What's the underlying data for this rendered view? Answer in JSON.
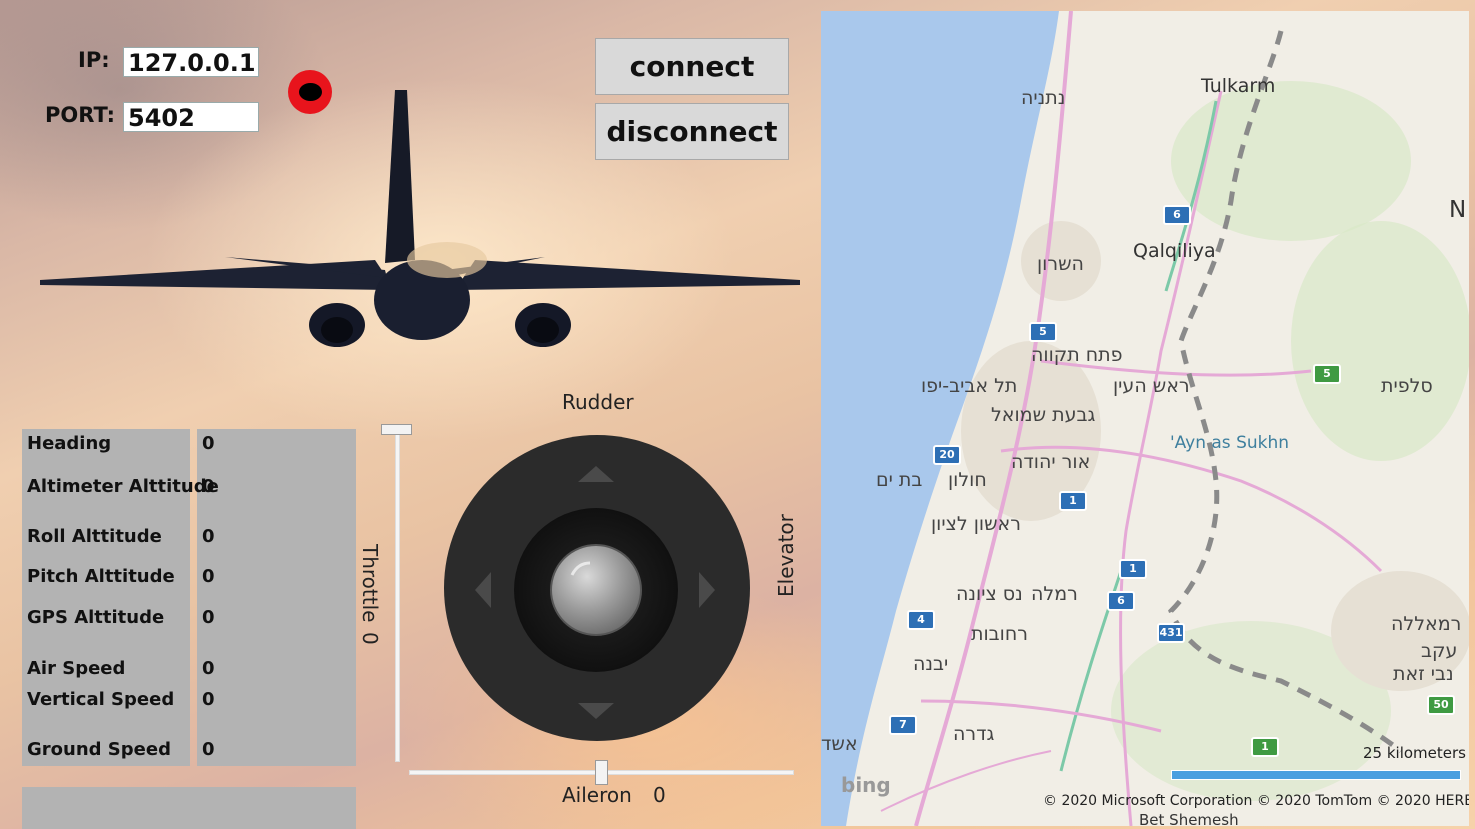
{
  "connection": {
    "ip_label": "IP:",
    "ip_value": "127.0.0.1",
    "port_label": "PORT:",
    "port_value": "5402",
    "connect_label": "connect",
    "disconnect_label": "disconnect"
  },
  "telemetry": [
    {
      "label": "Heading",
      "value": "0"
    },
    {
      "label": "Altimeter Alttitude",
      "value": "0"
    },
    {
      "label": "Roll Alttitude",
      "value": "0"
    },
    {
      "label": "Pitch Alttitude",
      "value": "0"
    },
    {
      "label": "GPS Alttitude",
      "value": "0"
    },
    {
      "label": "Air Speed",
      "value": "0"
    },
    {
      "label": "Vertical Speed",
      "value": "0"
    },
    {
      "label": "Ground Speed",
      "value": "0"
    }
  ],
  "controls": {
    "rudder_label": "Rudder",
    "elevator_label": "Elevator",
    "throttle_label": "Throttle",
    "throttle_value": "0",
    "aileron_label": "Aileron",
    "aileron_value": "0"
  },
  "map": {
    "labels": [
      "נתניה",
      "Tulkarm",
      "השרון",
      "Qalqiliya",
      "פתח תקווה",
      "תל אביב-יפו",
      "ראש העין",
      "גבעת שמואל",
      "סלפית",
      "'Ayn as Sukhn",
      "אור יהודה",
      "בת ים",
      "חולון",
      "ראשון לציון",
      "נס ציונה",
      "רמלה",
      "רחובות",
      "יבנה",
      "גדרה",
      "אשד",
      "רמאללה",
      "עקב",
      "נבי זאת",
      "N",
      "Bet Shemesh"
    ],
    "routes": [
      "6",
      "5",
      "5",
      "20",
      "1",
      "1",
      "6",
      "4",
      "431",
      "7",
      "50",
      "1"
    ],
    "bing": "bing",
    "scale": "25 kilometers",
    "copyright": "© 2020 Microsoft Corporation   © 2020 TomTom © 2020 HERE"
  },
  "colors": {
    "status_indicator": "#e8141c",
    "button_bg": "#d9d9d9",
    "panel_bg": "#b3b3b3",
    "sea": "#a9c8ec",
    "joystick_outer": "#2b2b2b"
  }
}
